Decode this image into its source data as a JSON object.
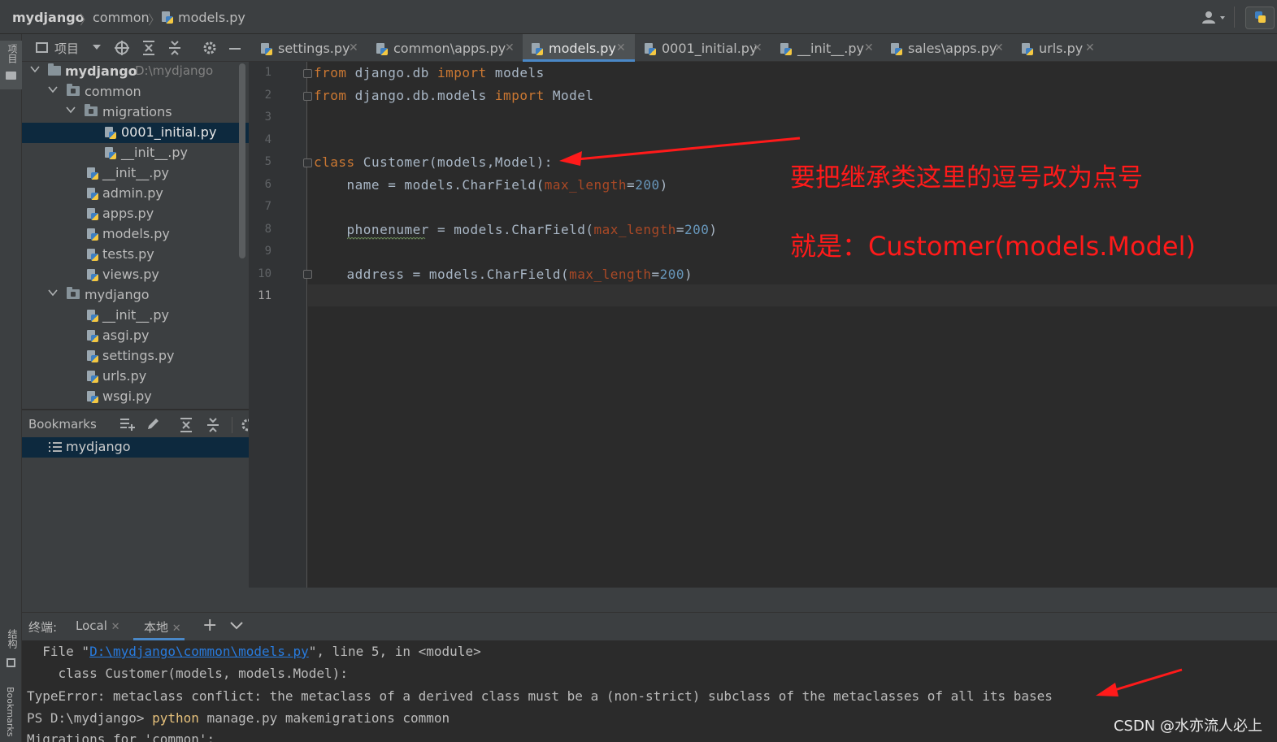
{
  "titlebar": {
    "project": "mydjango",
    "folder": "common",
    "file": "models.py"
  },
  "leftstrip": {
    "project_label": "项目",
    "structure_label": "结构",
    "bookmarks_label": "Bookmarks"
  },
  "project_panel": {
    "title": "项目",
    "tree": [
      {
        "label": "mydjango",
        "hint": "D:\\mydjango",
        "kind": "folder",
        "expanded": true
      },
      {
        "label": "common",
        "kind": "folder",
        "expanded": true
      },
      {
        "label": "migrations",
        "kind": "folder",
        "expanded": true
      },
      {
        "label": "0001_initial.py",
        "kind": "py",
        "selected": true
      },
      {
        "label": "__init__.py",
        "kind": "py"
      },
      {
        "label": "__init__.py",
        "kind": "py"
      },
      {
        "label": "admin.py",
        "kind": "py"
      },
      {
        "label": "apps.py",
        "kind": "py"
      },
      {
        "label": "models.py",
        "kind": "py"
      },
      {
        "label": "tests.py",
        "kind": "py"
      },
      {
        "label": "views.py",
        "kind": "py"
      },
      {
        "label": "mydjango",
        "kind": "folder",
        "expanded": true
      },
      {
        "label": "__init__.py",
        "kind": "py"
      },
      {
        "label": "asgi.py",
        "kind": "py"
      },
      {
        "label": "settings.py",
        "kind": "py"
      },
      {
        "label": "urls.py",
        "kind": "py"
      },
      {
        "label": "wsgi.py",
        "kind": "py"
      }
    ]
  },
  "bookmarks": {
    "title": "Bookmarks",
    "items": [
      {
        "label": "mydjango"
      }
    ]
  },
  "tabs": [
    {
      "label": "settings.py",
      "active": false
    },
    {
      "label": "common\\apps.py",
      "active": false
    },
    {
      "label": "models.py",
      "active": true
    },
    {
      "label": "0001_initial.py",
      "active": false
    },
    {
      "label": "__init__.py",
      "active": false
    },
    {
      "label": "sales\\apps.py",
      "active": false
    },
    {
      "label": "urls.py",
      "active": false
    }
  ],
  "editor": {
    "line_numbers": [
      "1",
      "2",
      "3",
      "4",
      "5",
      "6",
      "7",
      "8",
      "9",
      "10",
      "11"
    ],
    "lines": {
      "l1": {
        "kw1": "from",
        "mod": " django.db ",
        "kw2": "import",
        "name": " models"
      },
      "l2": {
        "kw1": "from",
        "mod": " django.db.models ",
        "kw2": "import",
        "name": " Model"
      },
      "l5": {
        "kw": "class",
        "rest": " Customer(models,Model):"
      },
      "l6": {
        "pre": "    name = models.CharField(",
        "param": "max_length",
        "eq": "=",
        "num": "200",
        "post": ")"
      },
      "l8": {
        "pre": "    phonenumer = models.CharField(",
        "param": "max_length",
        "eq": "=",
        "num": "200",
        "post": ")"
      },
      "l10": {
        "pre": "    address = models.CharField(",
        "param": "max_length",
        "eq": "=",
        "num": "200",
        "post": ")"
      }
    }
  },
  "annotations": {
    "line1": "要把继承类这里的逗号改为点号",
    "line2": "就是：Customer(models.Model)",
    "color": "#ff1a1a"
  },
  "terminal": {
    "label": "终端:",
    "tabs": [
      {
        "label": "Local",
        "active": false
      },
      {
        "label": "本地",
        "active": true
      }
    ],
    "lines": {
      "t1_pre": "  File \"",
      "t1_link": "D:\\mydjango\\common\\models.py",
      "t1_post": "\", line 5, in <module>",
      "t2": "    class Customer(models, models.Model):",
      "t3": "TypeError: metaclass conflict: the metaclass of a derived class must be a (non-strict) subclass of the metaclasses of all its bases",
      "t4_prompt": "PS D:\\mydjango> ",
      "t4_cmd": "python",
      "t4_args": " manage.py makemigrations common",
      "t5": "Migrations for 'common':"
    }
  },
  "watermark": "CSDN @水亦流人必上"
}
